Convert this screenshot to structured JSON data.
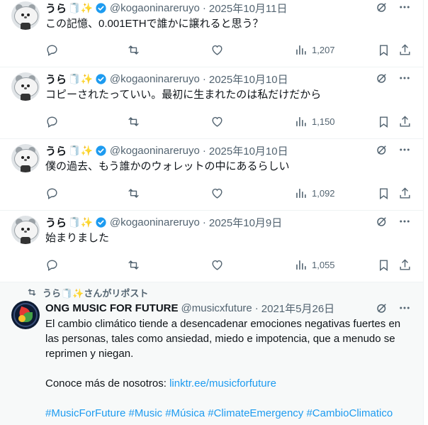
{
  "user": {
    "name": "うら",
    "emoji": "🧻✨",
    "handle": "@kogaoninareruyo"
  },
  "tweets": [
    {
      "date": "2025年10月11日",
      "text": "この記憶、0.001ETHで誰かに譲れると思う？",
      "views": "1,207"
    },
    {
      "date": "2025年10月10日",
      "text": "コピーされたっていい。最初に生まれたのは私だけだから",
      "views": "1,150"
    },
    {
      "date": "2025年10月10日",
      "text": "僕の過去、もう誰かのウォレットの中にあるらしい",
      "views": "1,092"
    },
    {
      "date": "2025年10月9日",
      "text": "始まりました",
      "views": "1,055"
    }
  ],
  "repost": {
    "label": "うら🧻✨さんがリポスト",
    "name": "ONG MUSIC FOR FUTURE",
    "handle": "@musicxfuture",
    "date": "2021年5月26日",
    "para1": "El cambio climático tiende a desencadenar emociones negativas fuertes en las personas, tales como ansiedad, miedo e impotencia, que a menudo se reprimen y niegan.",
    "para2_prefix": "Conoce más de nosotros: ",
    "para2_link": "linktr.ee/musicforfuture",
    "hashtags": "#MusicForFuture #Music #Música #ClimateEmergency #CambioClimatico"
  },
  "separator": "·",
  "colors": {
    "verified": "#1d9bf0",
    "link": "#1d9bf0",
    "muted": "#536471"
  }
}
